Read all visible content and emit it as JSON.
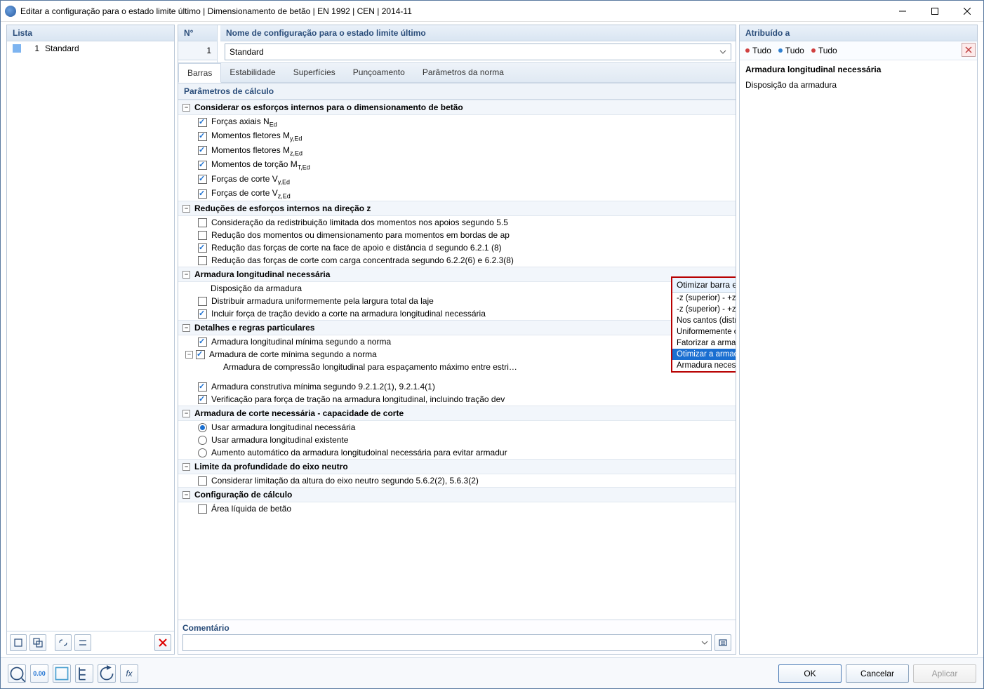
{
  "window": {
    "title": "Editar a configuração para o estado limite último | Dimensionamento de betão | EN 1992 | CEN | 2014-11"
  },
  "left": {
    "header": "Lista",
    "items": [
      {
        "num": "1",
        "label": "Standard"
      }
    ],
    "toolbar": [
      "new",
      "copy",
      "sep",
      "link",
      "link2",
      "sep",
      "delete"
    ]
  },
  "center": {
    "num_header": "N°",
    "num_value": "1",
    "name_header": "Nome de configuração para o estado limite último",
    "name_value": "Standard",
    "tabs": [
      "Barras",
      "Estabilidade",
      "Superfícies",
      "Punçoamento",
      "Parâmetros da norma"
    ],
    "active_tab": 0,
    "section_title": "Parâmetros de cálculo",
    "groups": [
      {
        "title": "Considerar os esforços internos para o dimensionamento de betão",
        "items": [
          {
            "type": "chk",
            "checked": true,
            "html": "Forças axiais N<sub>Ed</sub>"
          },
          {
            "type": "chk",
            "checked": true,
            "html": "Momentos fletores M<sub>y,Ed</sub>"
          },
          {
            "type": "chk",
            "checked": true,
            "html": "Momentos fletores M<sub>z,Ed</sub>"
          },
          {
            "type": "chk",
            "checked": true,
            "html": "Momentos de torção M<sub>T,Ed</sub>"
          },
          {
            "type": "chk",
            "checked": true,
            "html": "Forças de corte V<sub>y,Ed</sub>"
          },
          {
            "type": "chk",
            "checked": true,
            "html": "Forças de corte V<sub>z,Ed</sub>"
          }
        ]
      },
      {
        "title": "Reduções de esforços internos na direção z",
        "items": [
          {
            "type": "chk",
            "checked": false,
            "html": "Consideração da redistribuição limitada dos momentos nos apoios segundo 5.5"
          },
          {
            "type": "chk",
            "checked": false,
            "html": "Redução dos momentos ou dimensionamento para momentos em bordas de ap"
          },
          {
            "type": "chk",
            "checked": true,
            "html": "Redução das forças de corte na face de apoio e distância d segundo 6.2.1 (8)"
          },
          {
            "type": "chk",
            "checked": false,
            "html": "Redução das forças de corte com carga concentrada segundo 6.2.2(6) e 6.2.3(8)"
          }
        ]
      },
      {
        "title": "Armadura longitudinal necessária",
        "items": [
          {
            "type": "label",
            "html": "Disposição da armadura"
          },
          {
            "type": "chk",
            "checked": false,
            "html": "Distribuir armadura uniformemente pela largura total da laje"
          },
          {
            "type": "chk",
            "checked": true,
            "html": "Incluir força de tração devido a corte na armadura longitudinal necessária"
          }
        ]
      },
      {
        "title": "Detalhes e regras particulares",
        "items": [
          {
            "type": "chk",
            "checked": true,
            "html": "Armadura longitudinal mínima segundo a norma"
          },
          {
            "type": "chk",
            "checked": true,
            "sub_toggle": true,
            "html": "Armadura de corte mínima segundo a norma"
          },
          {
            "type": "text",
            "indent": true,
            "html": "Armadura de compressão longitudinal para espaçamento máximo entre estri…"
          },
          {
            "type": "spacer"
          },
          {
            "type": "chk",
            "checked": true,
            "html": "Armadura construtiva mínima segundo 9.2.1.2(1), 9.2.1.4(1)"
          },
          {
            "type": "chk",
            "checked": true,
            "html": "Verificação para força de tração na armadura longitudinal, incluindo tração dev"
          }
        ]
      },
      {
        "title": "Armadura de corte necessária - capacidade de corte",
        "items": [
          {
            "type": "rad",
            "checked": true,
            "html": "Usar armadura longitudinal necessária"
          },
          {
            "type": "rad",
            "checked": false,
            "html": "Usar armadura longitudinal existente"
          },
          {
            "type": "rad",
            "checked": false,
            "html": "Aumento automático da armadura longitudoinal necessária para evitar armadur"
          }
        ]
      },
      {
        "title": "Limite da profundidade do eixo neutro",
        "items": [
          {
            "type": "chk",
            "checked": false,
            "html": "Considerar limitação da altura do eixo neutro segundo 5.6.2(2), 5.6.3(2)"
          }
        ]
      },
      {
        "title": "Configuração de cálculo",
        "items": [
          {
            "type": "chk",
            "checked": false,
            "html": "Área líquida de betão"
          }
        ]
      }
    ],
    "dropdown": {
      "selected": "Otimizar barra existente",
      "options": [
        "-z (superior) - +z (inferior) (distribuição otimizada)",
        "-z (superior) - +z (inferior) (distribuição simétrica)",
        "Nos cantos (distribuição simétrica)",
        "Uniformemente circundante",
        "Fatorizar a armadura existente",
        "Otimizar a armadura existente",
        "Armadura necessária"
      ],
      "highlight": 5
    },
    "comment_header": "Comentário"
  },
  "right": {
    "header": "Atribuído a",
    "assign": [
      {
        "color": "#d04040",
        "label": "Tudo"
      },
      {
        "color": "#3080d0",
        "label": "Tudo"
      },
      {
        "color": "#d04040",
        "label": "Tudo"
      }
    ],
    "info_title": "Armadura longitudinal necessária",
    "info_sub": "Disposição da armadura"
  },
  "footer": {
    "ok": "OK",
    "cancel": "Cancelar",
    "apply": "Aplicar"
  }
}
